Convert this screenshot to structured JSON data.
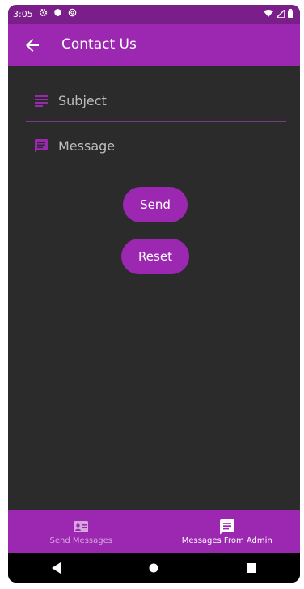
{
  "statusbar": {
    "time": "3:05"
  },
  "appbar": {
    "title": "Contact Us"
  },
  "form": {
    "subject": {
      "label": "Subject",
      "icon": "subject-icon"
    },
    "message": {
      "label": "Message",
      "icon": "message-icon"
    }
  },
  "buttons": {
    "send": "Send",
    "reset": "Reset"
  },
  "bottom_nav": {
    "items": [
      {
        "label": "Send Messages",
        "icon": "contact-card-icon",
        "active": false
      },
      {
        "label": "Messages From Admin",
        "icon": "chat-message-icon",
        "active": true
      }
    ]
  },
  "colors": {
    "primary": "#9c27b0",
    "status_bar": "#7a1f8a",
    "background": "#2b2b2b"
  }
}
